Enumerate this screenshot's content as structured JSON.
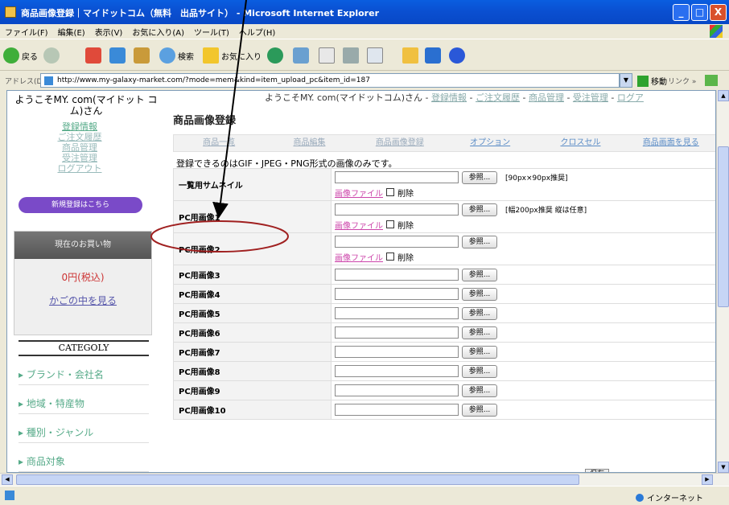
{
  "window": {
    "title": "商品画像登録｜マイドットコム（無料　出品サイト） - Microsoft Internet Explorer",
    "minimize": "_",
    "maximize": "□",
    "close": "X"
  },
  "menu": [
    "ファイル(F)",
    "編集(E)",
    "表示(V)",
    "お気に入り(A)",
    "ツール(T)",
    "ヘルプ(H)"
  ],
  "toolbar": {
    "back": "戻る",
    "search": "検索",
    "favorites": "お気に入り"
  },
  "address": {
    "label": "アドレス(D)",
    "url": "http://www.my-galaxy-market.com/?mode=mem&kind=item_upload_pc&item_id=187",
    "go": "移動",
    "links": "リンク »"
  },
  "top_links": {
    "welcome": "ようこそMY. com(マイドットコム)さん - ",
    "items": [
      "登録情報",
      "ご注文履歴",
      "商品管理",
      "受注管理",
      "ログア"
    ]
  },
  "sidebar": {
    "welcome": "ようこそMY. com(マイドット コム)さん",
    "links": [
      "登録情報",
      "ご注文履歴",
      "商品管理",
      "受注管理",
      "ログアウト"
    ],
    "banner": "新規登録はこちら",
    "cart_head": "現在のお買い物",
    "cart_price": "0円(税込)",
    "cart_link": "かごの中を見る",
    "category_title": "CATEGOLY",
    "categories": [
      "ブランド・会社名",
      "地域・特産物",
      "種別・ジャンル",
      "商品対象"
    ]
  },
  "main": {
    "title": "商品画像登録",
    "tabs": [
      "商品一覧",
      "商品編集",
      "商品画像登録",
      "オプション",
      "クロスセル",
      "商品画面を見る"
    ],
    "notice": "登録できるのはGIF・JPEG・PNG形式の画像のみです。",
    "browse": "参照...",
    "image_file": "画像ファイル",
    "delete": "削除",
    "save": "保存",
    "rows": [
      {
        "label": "一覧用サムネイル",
        "note": "[90px×90px推奨]",
        "has_file": true
      },
      {
        "label": "PC用画像1",
        "note": "[幅200px推奨 縦は任意]",
        "has_file": true
      },
      {
        "label": "PC用画像2",
        "note": "",
        "has_file": true
      },
      {
        "label": "PC用画像3",
        "note": "",
        "has_file": false
      },
      {
        "label": "PC用画像4",
        "note": "",
        "has_file": false
      },
      {
        "label": "PC用画像5",
        "note": "",
        "has_file": false
      },
      {
        "label": "PC用画像6",
        "note": "",
        "has_file": false
      },
      {
        "label": "PC用画像7",
        "note": "",
        "has_file": false
      },
      {
        "label": "PC用画像8",
        "note": "",
        "has_file": false
      },
      {
        "label": "PC用画像9",
        "note": "",
        "has_file": false
      },
      {
        "label": "PC用画像10",
        "note": "",
        "has_file": false
      }
    ]
  },
  "status": {
    "zone": "インターネット"
  },
  "colors": {
    "titlebar": "#0a4fd0",
    "annotation": "#a02020"
  }
}
